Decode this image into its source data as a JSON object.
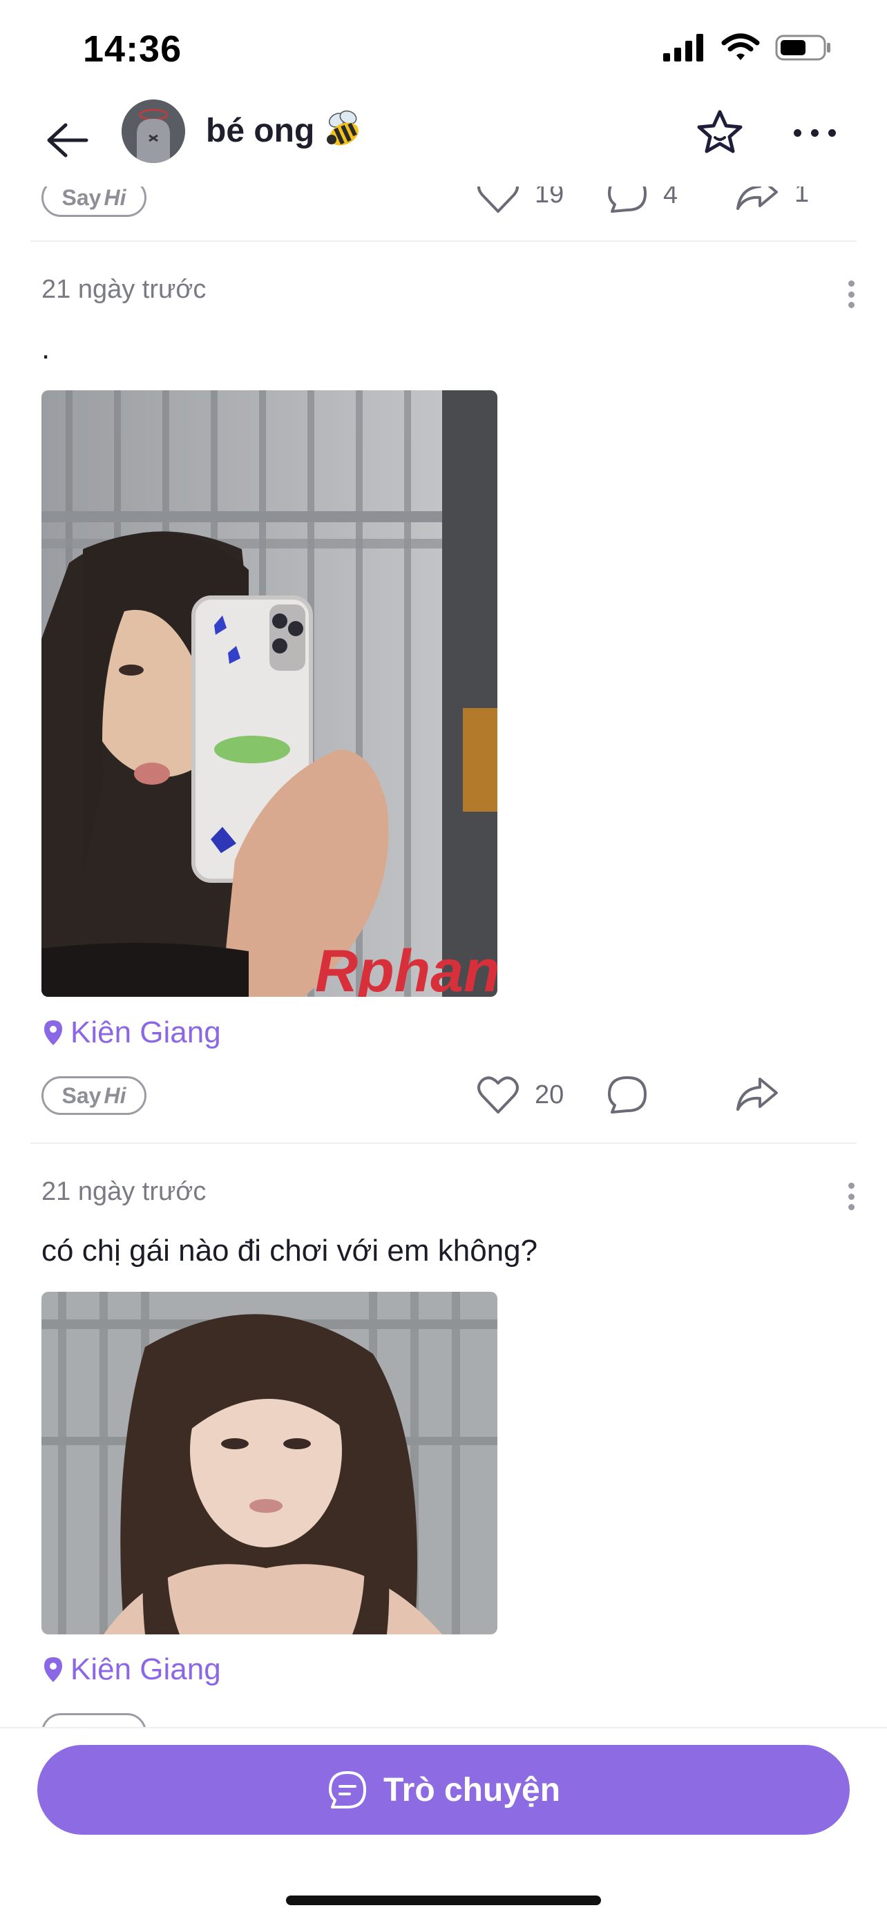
{
  "status_bar": {
    "time": "14:36"
  },
  "header": {
    "profile_name": "bé ong"
  },
  "posts": [
    {
      "say_hi": "Say",
      "say_hi_em": "Hi",
      "likes": "19",
      "comments": "4",
      "shares": "1"
    },
    {
      "date": "21 ngày trước",
      "text": ".",
      "watermark": "Rphang",
      "location": "Kiên Giang",
      "say_hi": "Say",
      "say_hi_em": "Hi",
      "likes": "20"
    },
    {
      "date": "21 ngày trước",
      "text": "có chị gái nào đi chơi với em không?",
      "location": "Kiên Giang"
    }
  ],
  "bottom": {
    "chat_label": "Trò chuyện"
  },
  "colors": {
    "accent": "#8d6be3",
    "location": "#8b67e6"
  }
}
